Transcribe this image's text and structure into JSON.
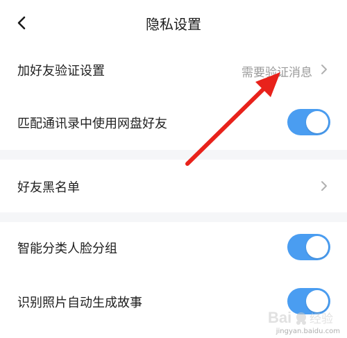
{
  "header": {
    "title": "隐私设置"
  },
  "settings": {
    "friend_verify": {
      "label": "加好友验证设置",
      "value": "需要验证消息"
    },
    "match_contacts": {
      "label": "匹配通讯录中使用网盘好友",
      "toggle_on": true
    },
    "blacklist": {
      "label": "好友黑名单"
    },
    "face_group": {
      "label": "智能分类人脸分组",
      "toggle_on": true
    },
    "photo_story": {
      "label": "识别照片自动生成故事",
      "toggle_on": true
    }
  },
  "colors": {
    "toggle_on": "#4a9df1",
    "annotation_arrow": "#e8221b",
    "band": "#f5f6f8"
  },
  "watermark": {
    "logo_text": "Bai 经验",
    "url": "jingyan.baidu.com"
  }
}
